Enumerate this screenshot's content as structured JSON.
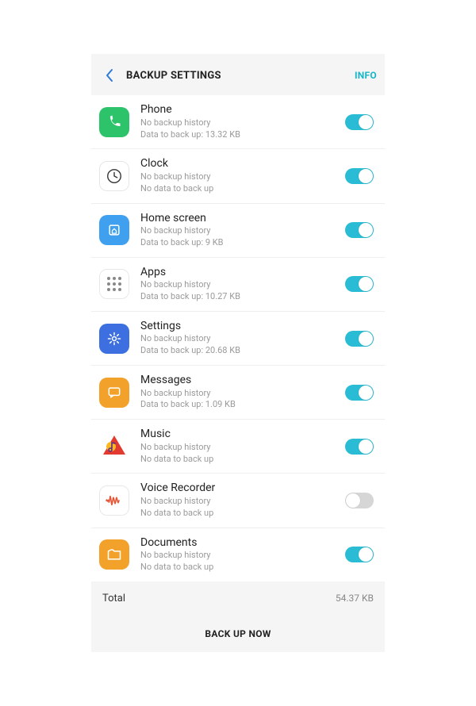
{
  "header": {
    "title": "BACKUP SETTINGS",
    "info_label": "INFO"
  },
  "items": [
    {
      "id": "phone",
      "title": "Phone",
      "sub1": "No backup history",
      "sub2": "Data to back up: 13.32 KB",
      "enabled": true
    },
    {
      "id": "clock",
      "title": "Clock",
      "sub1": "No backup history",
      "sub2": "No data to back up",
      "enabled": true
    },
    {
      "id": "home",
      "title": "Home screen",
      "sub1": "No backup history",
      "sub2": "Data to back up: 9 KB",
      "enabled": true
    },
    {
      "id": "apps",
      "title": "Apps",
      "sub1": "No backup history",
      "sub2": "Data to back up: 10.27 KB",
      "enabled": true
    },
    {
      "id": "settings",
      "title": "Settings",
      "sub1": "No backup history",
      "sub2": "Data to back up: 20.68 KB",
      "enabled": true
    },
    {
      "id": "messages",
      "title": "Messages",
      "sub1": "No backup history",
      "sub2": "Data to back up: 1.09 KB",
      "enabled": true
    },
    {
      "id": "music",
      "title": "Music",
      "sub1": "No backup history",
      "sub2": "No data to back up",
      "enabled": true
    },
    {
      "id": "voice",
      "title": "Voice Recorder",
      "sub1": "No backup history",
      "sub2": "No data to back up",
      "enabled": false
    },
    {
      "id": "docs",
      "title": "Documents",
      "sub1": "No backup history",
      "sub2": "No data to back up",
      "enabled": true
    }
  ],
  "total": {
    "label": "Total",
    "value": "54.37 KB"
  },
  "action": {
    "label": "BACK UP NOW"
  }
}
